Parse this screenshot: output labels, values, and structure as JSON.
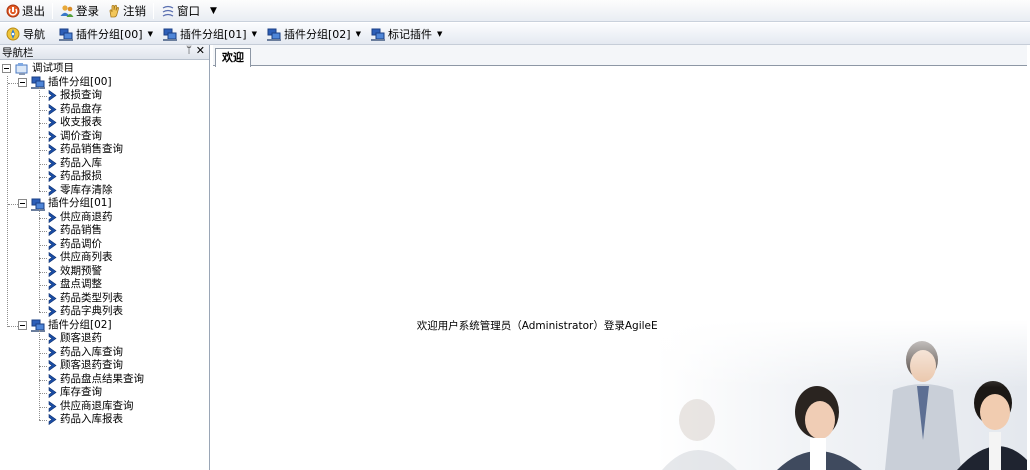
{
  "menubar": {
    "items": [
      {
        "label": "退出",
        "icon": "exit-icon"
      },
      {
        "label": "登录",
        "icon": "users-icon"
      },
      {
        "label": "注销",
        "icon": "logout-hand-icon"
      },
      {
        "label": "窗口",
        "icon": "window-icon"
      }
    ]
  },
  "toolbar": {
    "nav_label": "导航",
    "groups": [
      "插件分组[00]",
      "插件分组[01]",
      "插件分组[02]",
      "标记插件"
    ]
  },
  "navpanel": {
    "title": "导航栏",
    "root": "调试项目",
    "groups": [
      {
        "label": "插件分组[00]",
        "items": [
          "报损查询",
          "药品盘存",
          "收支报表",
          "调价查询",
          "药品销售查询",
          "药品入库",
          "药品报损",
          "零库存清除"
        ]
      },
      {
        "label": "插件分组[01]",
        "items": [
          "供应商退药",
          "药品销售",
          "药品调价",
          "供应商列表",
          "效期预警",
          "盘点调整",
          "药品类型列表",
          "药品字典列表"
        ]
      },
      {
        "label": "插件分组[02]",
        "items": [
          "顾客退药",
          "药品入库查询",
          "顾客退药查询",
          "药品盘点结果查询",
          "库存查询",
          "供应商退库查询",
          "药品入库报表"
        ]
      }
    ]
  },
  "content": {
    "tab_label": "欢迎",
    "welcome_text": "欢迎用户系统管理员（Administrator）登录AgileEAS.NET应用开发平台。"
  },
  "colors": {
    "accent_blue": "#1f5fbf",
    "chevron_blue": "#1b4fa8",
    "exit_red": "#d8451a"
  }
}
